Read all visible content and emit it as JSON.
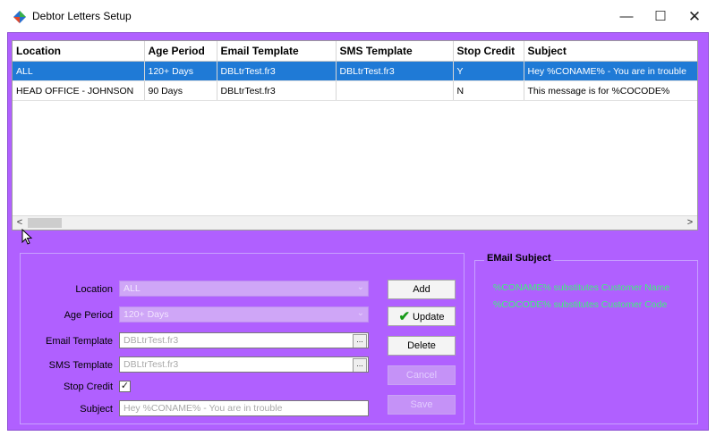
{
  "window": {
    "title": "Debtor Letters Setup",
    "minimize_glyph": "—",
    "maximize_glyph": "☐",
    "close_glyph": "✕"
  },
  "grid": {
    "columns": [
      "Location",
      "Age Period",
      "Email Template",
      "SMS Template",
      "Stop Credit",
      "Subject"
    ],
    "rows": [
      {
        "location": "ALL",
        "age_period": "120+ Days",
        "email_template": "DBLtrTest.fr3",
        "sms_template": "DBLtrTest.fr3",
        "stop_credit": "Y",
        "subject": "Hey %CONAME% - You are in trouble",
        "selected": true
      },
      {
        "location": "HEAD OFFICE - JOHNSON",
        "age_period": "90 Days",
        "email_template": "DBLtrTest.fr3",
        "sms_template": "",
        "stop_credit": "N",
        "subject": "This message is for %COCODE%",
        "selected": false
      }
    ],
    "scroll_left": "<",
    "scroll_right": ">"
  },
  "form": {
    "location": {
      "label": "Location",
      "value": "ALL",
      "enabled": false
    },
    "age_period": {
      "label": "Age Period",
      "value": "120+ Days",
      "enabled": false
    },
    "email_template": {
      "label": "Email Template",
      "value": "DBLtrTest.fr3"
    },
    "sms_template": {
      "label": "SMS Template",
      "value": "DBLtrTest.fr3"
    },
    "stop_credit": {
      "label": "Stop Credit",
      "checked": true
    },
    "subject": {
      "label": "Subject",
      "value": "Hey %CONAME% - You are in trouble"
    },
    "ellipsis": "..."
  },
  "buttons": {
    "add": "Add",
    "update": "Update",
    "delete": "Delete",
    "cancel": "Cancel",
    "save": "Save"
  },
  "email_subject": {
    "title": "EMail Subject",
    "lines": [
      "%CONAME% substitutes Customer Name",
      "%COCODE% substitutes Customer Code"
    ]
  },
  "colors": {
    "client_bg": "#b060ff",
    "selection": "#1f7ad6",
    "hint_text": "#3ef27a"
  }
}
